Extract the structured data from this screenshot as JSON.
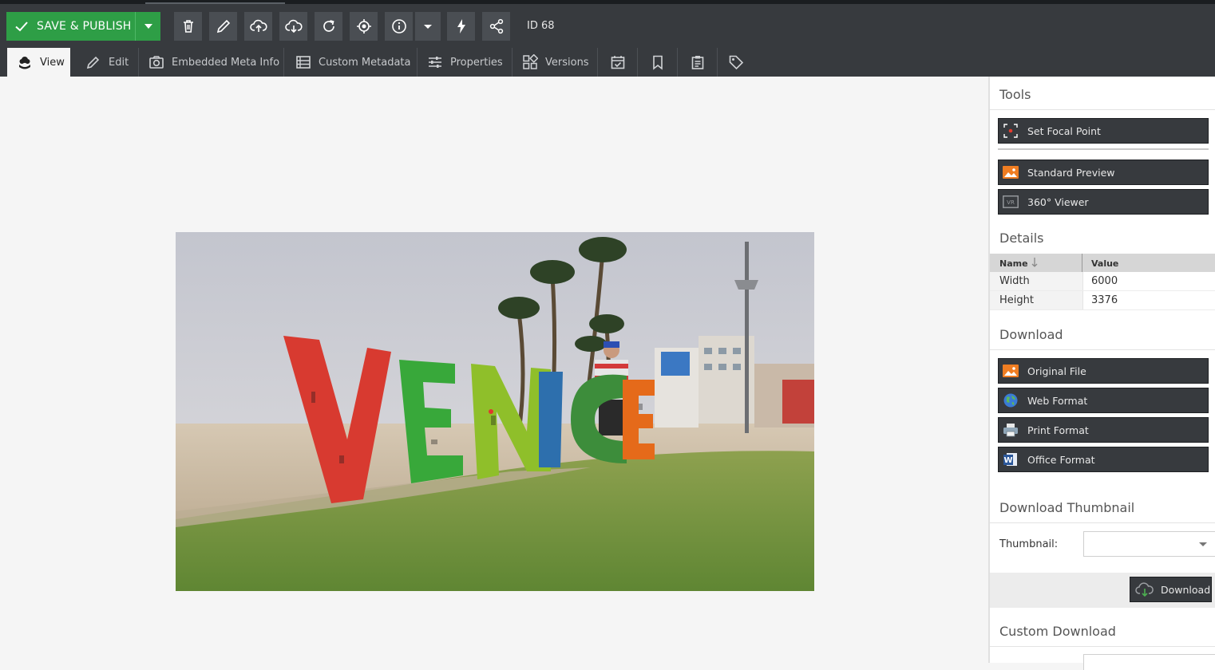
{
  "toolbar": {
    "save_label": "SAVE & PUBLISH",
    "id_label": "ID 68",
    "buttons": [
      "trash-icon",
      "pencil-icon",
      "upload-cloud-icon",
      "download-cloud-icon",
      "reload-icon",
      "target-icon",
      "info-icon",
      "chevron-down-icon",
      "bolt-icon",
      "share-icon"
    ]
  },
  "tabs": [
    {
      "label": "View",
      "icon": "flower-icon",
      "active": true
    },
    {
      "label": "Edit",
      "icon": "pencil-icon"
    },
    {
      "label": "Embedded Meta Info",
      "icon": "camera-icon"
    },
    {
      "label": "Custom Metadata",
      "icon": "metadata-icon"
    },
    {
      "label": "Properties",
      "icon": "sliders-icon"
    },
    {
      "label": "Versions",
      "icon": "versions-icon"
    },
    {
      "label": "",
      "icon": "calendar-check-icon"
    },
    {
      "label": "",
      "icon": "bookmark-icon"
    },
    {
      "label": "",
      "icon": "clipboard-icon"
    },
    {
      "label": "",
      "icon": "tag-icon"
    }
  ],
  "image": {
    "sign_letters": [
      "V",
      "E",
      "N",
      "I",
      "C",
      "E"
    ],
    "colors": {
      "sky": "#c9cbd3",
      "sand": "#cbbba3",
      "grass": "#6b8f3a"
    }
  },
  "panel": {
    "tools_title": "Tools",
    "tools": [
      {
        "label": "Set Focal Point",
        "icon": "focal-point-icon"
      },
      {
        "label": "Standard Preview",
        "icon": "image-icon"
      },
      {
        "label": "360° Viewer",
        "icon": "vr-icon"
      }
    ],
    "details_title": "Details",
    "details_columns": {
      "name": "Name",
      "value": "Value"
    },
    "details_rows": [
      {
        "name": "Width",
        "value": "6000"
      },
      {
        "name": "Height",
        "value": "3376"
      }
    ],
    "download_title": "Download",
    "downloads": [
      {
        "label": "Original File",
        "icon": "image-icon"
      },
      {
        "label": "Web Format",
        "icon": "globe-icon"
      },
      {
        "label": "Print Format",
        "icon": "printer-icon"
      },
      {
        "label": "Office Format",
        "icon": "word-icon"
      }
    ],
    "thumbnail_title": "Download Thumbnail",
    "thumbnail_label": "Thumbnail:",
    "thumbnail_value": "",
    "download_button": "Download",
    "custom_title": "Custom Download"
  },
  "colors": {
    "toolbar": "#373a3e",
    "save": "#2e9e46",
    "panel_button": "#373a3e"
  }
}
